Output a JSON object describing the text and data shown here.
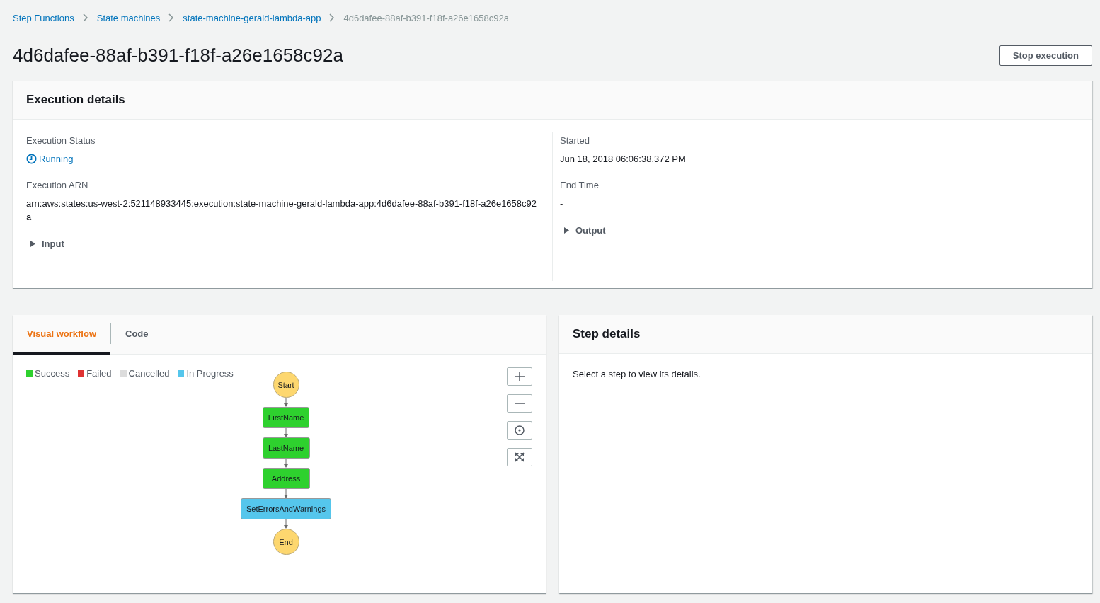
{
  "breadcrumbs": [
    {
      "label": "Step Functions",
      "kind": "link"
    },
    {
      "label": "State machines",
      "kind": "link"
    },
    {
      "label": "state-machine-gerald-lambda-app",
      "kind": "link"
    },
    {
      "label": "4d6dafee-88af-b391-f18f-a26e1658c92a",
      "kind": "current"
    }
  ],
  "title": "4d6dafee-88af-b391-f18f-a26e1658c92a",
  "stop_button": "Stop execution",
  "execution_details": {
    "heading": "Execution details",
    "left": [
      {
        "kind": "status",
        "label": "Execution Status",
        "value": "Running"
      },
      {
        "kind": "text",
        "label": "Execution ARN",
        "value": "arn:aws:states:us-west-2:521148933445:execution:state-machine-gerald-lambda-app:4d6dafee-88af-b391-f18f-a26e1658c92a"
      },
      {
        "kind": "expander",
        "label": "Input",
        "expanded": false
      }
    ],
    "right": [
      {
        "kind": "text",
        "label": "Started",
        "value": "Jun 18, 2018 06:06:38.372 PM"
      },
      {
        "kind": "text",
        "label": "End Time",
        "value": "-"
      },
      {
        "kind": "expander",
        "label": "Output",
        "expanded": false
      }
    ]
  },
  "tabs": [
    {
      "label": "Visual workflow",
      "selected": true
    },
    {
      "label": "Code",
      "selected": false
    }
  ],
  "legend": [
    {
      "label": "Success",
      "color": "#2ed12e"
    },
    {
      "label": "Failed",
      "color": "#df3232"
    },
    {
      "label": "Cancelled",
      "color": "#dcdcdc"
    },
    {
      "label": "In Progress",
      "color": "#55c6ec"
    }
  ],
  "workflow": [
    {
      "kind": "terminal",
      "label": "Start"
    },
    {
      "kind": "task",
      "label": "FirstName",
      "color": "#2ed12e"
    },
    {
      "kind": "task",
      "label": "LastName",
      "color": "#2ed12e"
    },
    {
      "kind": "task",
      "label": "Address",
      "color": "#2ed12e"
    },
    {
      "kind": "task",
      "label": "SetErrorsAndWarnings",
      "color": "#55c6ec"
    },
    {
      "kind": "terminal",
      "label": "End"
    }
  ],
  "step_details": {
    "heading": "Step details",
    "message": "Select a step to view its details."
  }
}
